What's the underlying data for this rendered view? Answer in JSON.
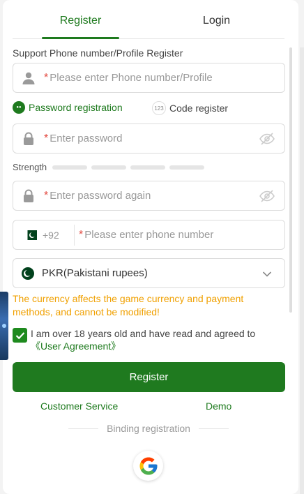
{
  "tabs": {
    "register": "Register",
    "login": "Login"
  },
  "form": {
    "section_label": "Support Phone number/Profile Register",
    "account_placeholder": "Please enter Phone number/Profile",
    "mode_password": "Password registration",
    "mode_code": "Code register",
    "mode_code_badge": "123",
    "password_placeholder": "Enter password",
    "strength_label": "Strength",
    "confirm_placeholder": "Enter password again",
    "country_code": "+92",
    "phone_placeholder": "Please enter phone number",
    "currency": "PKR(Pakistani rupees)",
    "currency_warning": "The currency affects the game currency and payment methods, and cannot be modified!",
    "agree_text": "I am over 18 years old and have read and agreed to ",
    "agree_link": "《User Agreement》",
    "submit": "Register"
  },
  "footer": {
    "customer_service": "Customer Service",
    "demo": "Demo",
    "binding": "Binding registration"
  },
  "colors": {
    "brand": "#1e7a1e",
    "warning": "#f0a000",
    "required": "#e2453c"
  },
  "icons": [
    "user-icon",
    "lock-icon",
    "eye-off-icon",
    "pakistan-flag-icon",
    "chevron-down-icon",
    "checkmark-icon",
    "google-icon"
  ]
}
